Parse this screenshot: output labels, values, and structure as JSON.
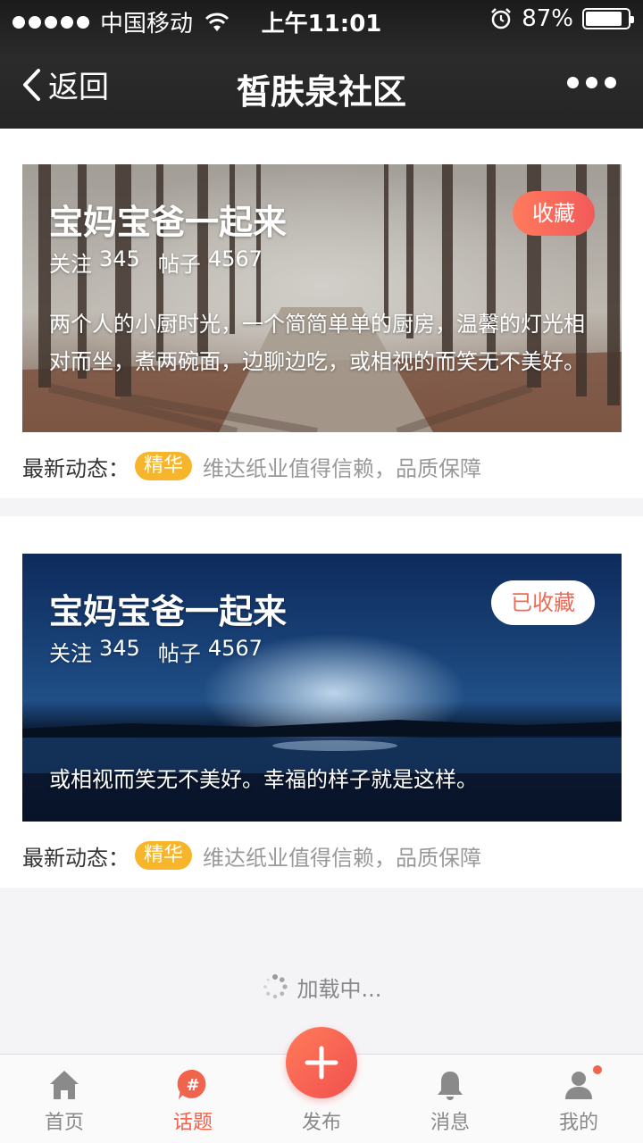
{
  "status_bar": {
    "carrier": "中国移动",
    "time": "上午11:01",
    "battery": "87%",
    "battery_level": 0.87
  },
  "nav": {
    "back_label": "返回",
    "title": "皙肤泉社区",
    "more_icon": "more-dots-icon"
  },
  "communities": [
    {
      "title": "宝妈宝爸一起来",
      "follow_label": "关注",
      "follow_count": "345",
      "posts_label": "帖子",
      "posts_count": "4567",
      "description": "两个人的小厨时光，一个简简单单的厨房，温馨的灯光相对而坐，煮两碗面，边聊边吃，或相视的而笑无不美好。",
      "fav_label": "收藏",
      "fav_state": "not-favorited",
      "latest_label": "最新动态：",
      "latest_tag": "精华",
      "latest_text": "维达纸业值得信赖，品质保障"
    },
    {
      "title": "宝妈宝爸一起来",
      "follow_label": "关注",
      "follow_count": "345",
      "posts_label": "帖子",
      "posts_count": "4567",
      "description": "或相视而笑无不美好。幸福的样子就是这样。",
      "fav_label": "已收藏",
      "fav_state": "favorited",
      "latest_label": "最新动态：",
      "latest_tag": "精华",
      "latest_text": "维达纸业值得信赖，品质保障"
    }
  ],
  "loading_text": "加载中...",
  "tabs": [
    {
      "label": "首页",
      "icon": "home-icon",
      "active": false
    },
    {
      "label": "话题",
      "icon": "topic-hash-icon",
      "active": true
    },
    {
      "label": "发布",
      "icon": "plus-icon",
      "active": false
    },
    {
      "label": "消息",
      "icon": "bell-icon",
      "active": false
    },
    {
      "label": "我的",
      "icon": "user-icon",
      "active": false
    }
  ],
  "colors": {
    "accent": "#f0634d",
    "tag_yellow": "#f7b52c",
    "navbar": "#222222"
  }
}
